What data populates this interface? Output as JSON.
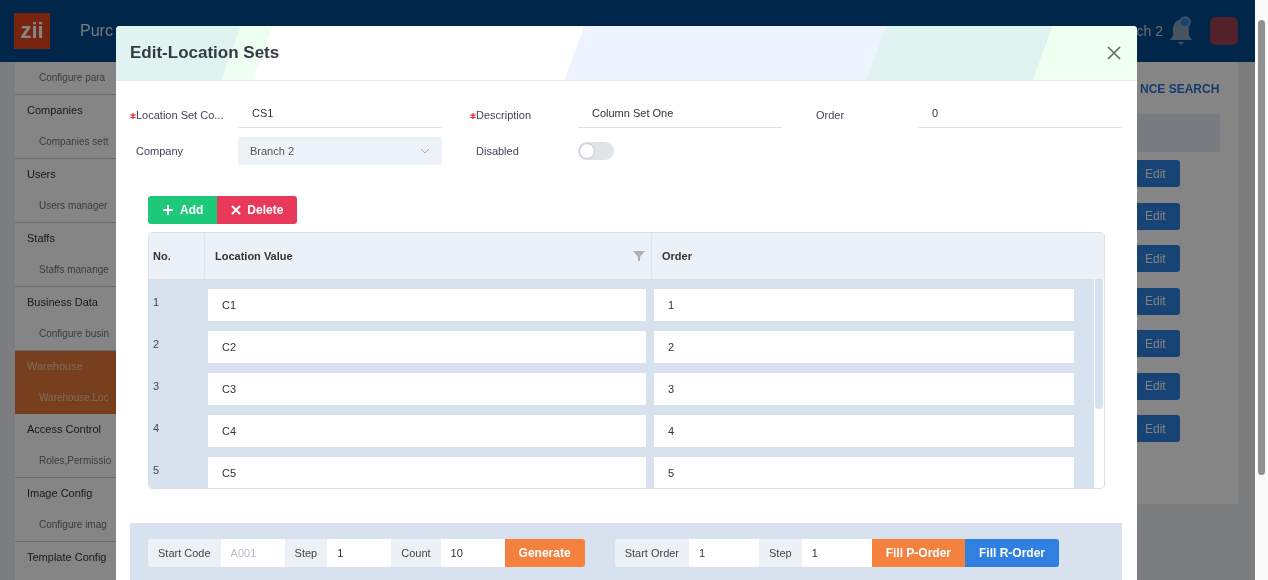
{
  "app": {
    "logo": "zii",
    "title": "Purc",
    "branch": "ch 2",
    "advanced_search": "NCE SEARCH",
    "sidebar": [
      {
        "label": "Configure para",
        "kind": "sub",
        "selected": false
      },
      {
        "label": "Companies",
        "kind": "head",
        "selected": false
      },
      {
        "label": "Companies sett",
        "kind": "sub",
        "selected": false
      },
      {
        "label": "Users",
        "kind": "head",
        "selected": false
      },
      {
        "label": "Users manager",
        "kind": "sub",
        "selected": false
      },
      {
        "label": "Staffs",
        "kind": "head",
        "selected": false
      },
      {
        "label": "Staffs manange",
        "kind": "sub",
        "selected": false
      },
      {
        "label": "Business Data",
        "kind": "head",
        "selected": false
      },
      {
        "label": "Configure busin",
        "kind": "sub",
        "selected": false
      },
      {
        "label": "Warehouse",
        "kind": "head",
        "selected": true
      },
      {
        "label": "Warehouse,Loc",
        "kind": "sub",
        "selected": true
      },
      {
        "label": "Access Control",
        "kind": "head",
        "selected": false
      },
      {
        "label": "Roles,Permissio",
        "kind": "sub",
        "selected": false
      },
      {
        "label": "Image Config",
        "kind": "head",
        "selected": false
      },
      {
        "label": "Configure imag",
        "kind": "sub",
        "selected": false
      },
      {
        "label": "Template Config",
        "kind": "head",
        "selected": false
      }
    ],
    "edit_buttons": [
      "Edit",
      "Edit",
      "Edit",
      "Edit",
      "Edit",
      "Edit",
      "Edit"
    ]
  },
  "dialog": {
    "title": "Edit-Location Sets",
    "fields": [
      {
        "label": "Location Set Co...",
        "required": true,
        "kind": "text",
        "value": "CS1"
      },
      {
        "label": "Description",
        "required": true,
        "kind": "text",
        "value": "Column Set One"
      },
      {
        "label": "Order",
        "required": false,
        "kind": "text",
        "value": "0"
      },
      {
        "label": "Company",
        "required": false,
        "kind": "select",
        "value": "Branch 2"
      },
      {
        "label": "Disabled",
        "required": false,
        "kind": "toggle",
        "on": false
      }
    ],
    "add_button": "Add",
    "delete_button": "Delete",
    "table": {
      "columns": [
        "No.",
        "Location Value",
        "Order"
      ],
      "rows": [
        {
          "no": "1",
          "value": "C1",
          "order": "1"
        },
        {
          "no": "2",
          "value": "C2",
          "order": "2"
        },
        {
          "no": "3",
          "value": "C3",
          "order": "3"
        },
        {
          "no": "4",
          "value": "C4",
          "order": "4"
        },
        {
          "no": "5",
          "value": "C5",
          "order": "5"
        }
      ]
    },
    "generator": {
      "start_code_label": "Start Code",
      "start_code_placeholder": "A001",
      "step_label": "Step",
      "step_value": "1",
      "count_label": "Count",
      "count_value": "10",
      "generate_button": "Generate",
      "start_order_label": "Start Order",
      "start_order_value": "1",
      "order_step_label": "Step",
      "order_step_value": "1",
      "fill_p_button": "Fill P-Order",
      "fill_r_button": "Fill R-Order"
    }
  }
}
